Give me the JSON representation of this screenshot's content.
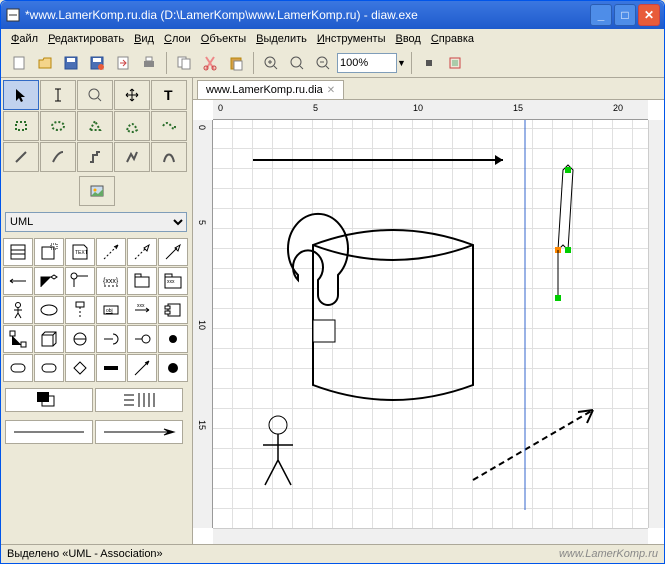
{
  "window": {
    "title": "*www.LamerKomp.ru.dia (D:\\LamerKomp\\www.LamerKomp.ru) - diaw.exe"
  },
  "menu": {
    "file": "Файл",
    "edit": "Редактировать",
    "view": "Вид",
    "layers": "Слои",
    "objects": "Объекты",
    "select": "Выделить",
    "tools": "Инструменты",
    "input": "Ввод",
    "help": "Справка"
  },
  "toolbar": {
    "zoom": "100%"
  },
  "shapeset": {
    "selected": "UML"
  },
  "tab": {
    "label": "www.LamerKomp.ru.dia"
  },
  "ruler": {
    "h": [
      "0",
      "5",
      "10",
      "15",
      "20"
    ],
    "v": [
      "0",
      "5",
      "10",
      "15"
    ]
  },
  "status": {
    "text": "Выделено «UML - Association»",
    "watermark": "www.LamerKomp.ru"
  }
}
